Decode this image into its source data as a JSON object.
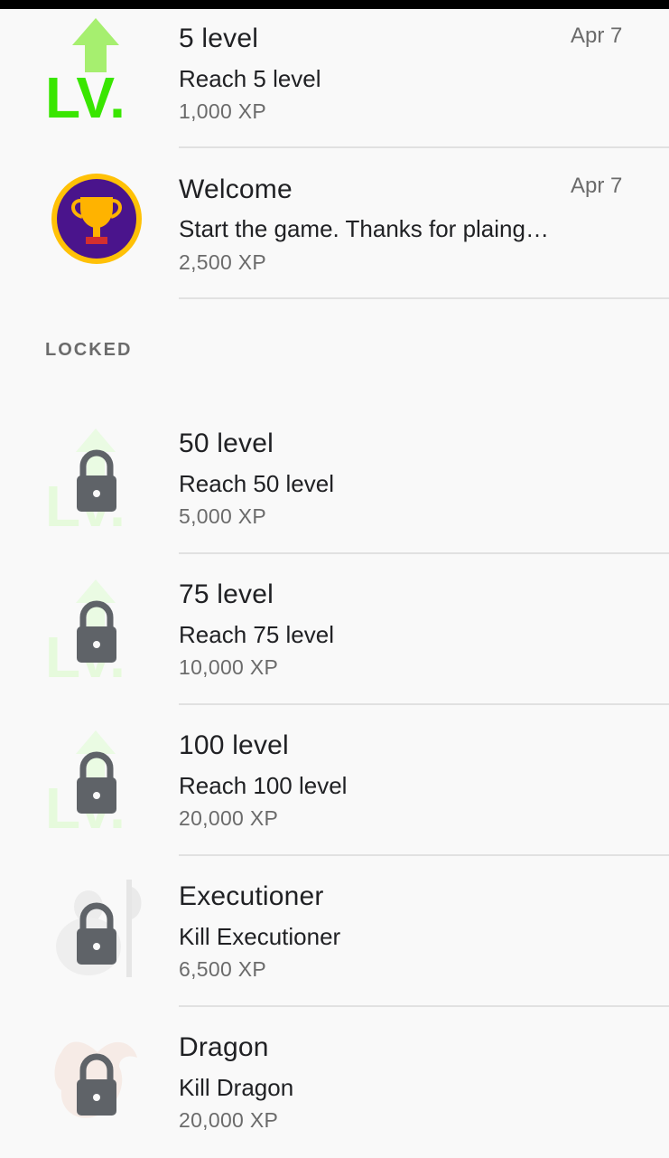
{
  "unlocked_section": {
    "items": [
      {
        "title": "5 level",
        "description": "Reach 5 level",
        "xp": "1,000 XP",
        "date": "Apr 7",
        "icon": "level-up-icon"
      },
      {
        "title": "Welcome",
        "description": "Start the game. Thanks for plaing…",
        "xp": "2,500 XP",
        "date": "Apr 7",
        "icon": "trophy-icon"
      }
    ]
  },
  "locked_section": {
    "label": "LOCKED",
    "items": [
      {
        "title": "50 level",
        "description": "Reach 50 level",
        "xp": "5,000 XP",
        "icon": "locked-level-icon"
      },
      {
        "title": "75 level",
        "description": "Reach 75 level",
        "xp": "10,000 XP",
        "icon": "locked-level-icon"
      },
      {
        "title": "100 level",
        "description": "Reach 100 level",
        "xp": "20,000 XP",
        "icon": "locked-level-icon"
      },
      {
        "title": "Executioner",
        "description": "Kill Executioner",
        "xp": "6,500 XP",
        "icon": "locked-executioner-icon"
      },
      {
        "title": "Dragon",
        "description": "Kill Dragon",
        "xp": "20,000 XP",
        "icon": "locked-dragon-icon"
      }
    ]
  },
  "colors": {
    "level_green": "#39e600",
    "trophy_purple": "#4a148c",
    "trophy_ring": "#ffc107",
    "lock_gray": "#5f6368",
    "xp_gray": "#6b6b6b"
  }
}
